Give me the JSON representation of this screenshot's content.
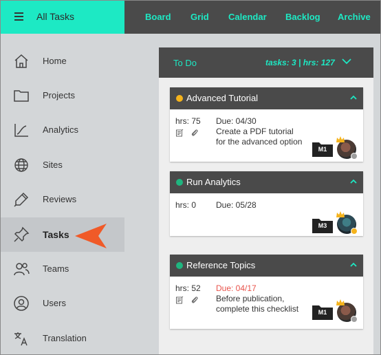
{
  "app": {
    "title": "All Tasks"
  },
  "nav": {
    "tabs": [
      {
        "label": "Board"
      },
      {
        "label": "Grid"
      },
      {
        "label": "Calendar"
      },
      {
        "label": "Backlog"
      },
      {
        "label": "Archive"
      }
    ]
  },
  "sidebar": {
    "items": [
      {
        "label": "Home",
        "icon": "home-icon"
      },
      {
        "label": "Projects",
        "icon": "folder-icon"
      },
      {
        "label": "Analytics",
        "icon": "chart-icon"
      },
      {
        "label": "Sites",
        "icon": "globe-icon"
      },
      {
        "label": "Reviews",
        "icon": "pen-icon"
      },
      {
        "label": "Tasks",
        "icon": "pin-icon",
        "active": true
      },
      {
        "label": "Teams",
        "icon": "people-icon"
      },
      {
        "label": "Users",
        "icon": "user-icon"
      },
      {
        "label": "Translation",
        "icon": "translate-icon"
      }
    ]
  },
  "column": {
    "title": "To Do",
    "stats": "tasks: 3 | hrs: 127"
  },
  "cards": [
    {
      "title": "Advanced Tutorial",
      "status_color": "#f5b31c",
      "hrs": "hrs: 75",
      "due": "Due: 04/30",
      "overdue": false,
      "description": "Create a PDF tutorial for the advanced option",
      "milestone": "M1",
      "badge_color": "#9e9e9e",
      "has_attachments": true
    },
    {
      "title": "Run Analytics",
      "status_color": "#1fb57f",
      "hrs": "hrs: 0",
      "due": "Due: 05/28",
      "overdue": false,
      "description": "",
      "milestone": "M3",
      "badge_color": "#f5b31c",
      "has_attachments": false
    },
    {
      "title": "Reference Topics",
      "status_color": "#1fb57f",
      "hrs": "hrs: 52",
      "due": "Due: 04/17",
      "overdue": true,
      "description": "Before publication, complete this checklist",
      "milestone": "M1",
      "badge_color": "#9e9e9e",
      "has_attachments": true
    }
  ],
  "colors": {
    "accent": "#1de9c4",
    "header_dark": "#4a4a4a",
    "overdue": "#e8524a",
    "pointer": "#f05a28"
  }
}
